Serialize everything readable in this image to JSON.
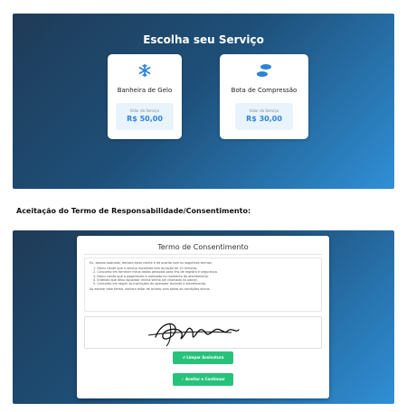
{
  "service_page": {
    "title": "Escolha seu Serviço",
    "services": [
      {
        "icon": "snowflake-icon",
        "name": "Banheira de Gelo",
        "price_label": "Valor do Serviço",
        "price": "R$ 50,00"
      },
      {
        "icon": "footprints-icon",
        "name": "Bota de Compressão",
        "price_label": "Valor do Serviço",
        "price": "R$ 30,00"
      }
    ]
  },
  "section_heading": "Aceitação do Termo de Responsabilidade/Consentimento:",
  "consent": {
    "title": "Termo de Consentimento",
    "intro": "Eu, abaixo assinado, declaro estar ciente e de acordo com os seguintes termos:",
    "items": [
      "1. Estou ciente que o serviço escolhido tem duração de 10 minutos.",
      "2. Concordo em fornecer meus dados pessoais para fins de registro e segurança.",
      "3. Estou ciente que o pagamento é realizado no momento do atendimento.",
      "4. Entendo que devo aguardar minha senha ser chamada no painel.",
      "5. Concordo em seguir as instruções do operador durante o atendimento."
    ],
    "closing": "Ao assinar este termo, declaro estar de acordo com todas as condições acima.",
    "clear_button": "Limpar Assinatura",
    "accept_button": "Aceitar e Continuar"
  },
  "colors": {
    "accent": "#2b83d6",
    "success": "#27c27a",
    "gradient_dark": "#1f3b57",
    "gradient_light": "#2f8fd6"
  }
}
